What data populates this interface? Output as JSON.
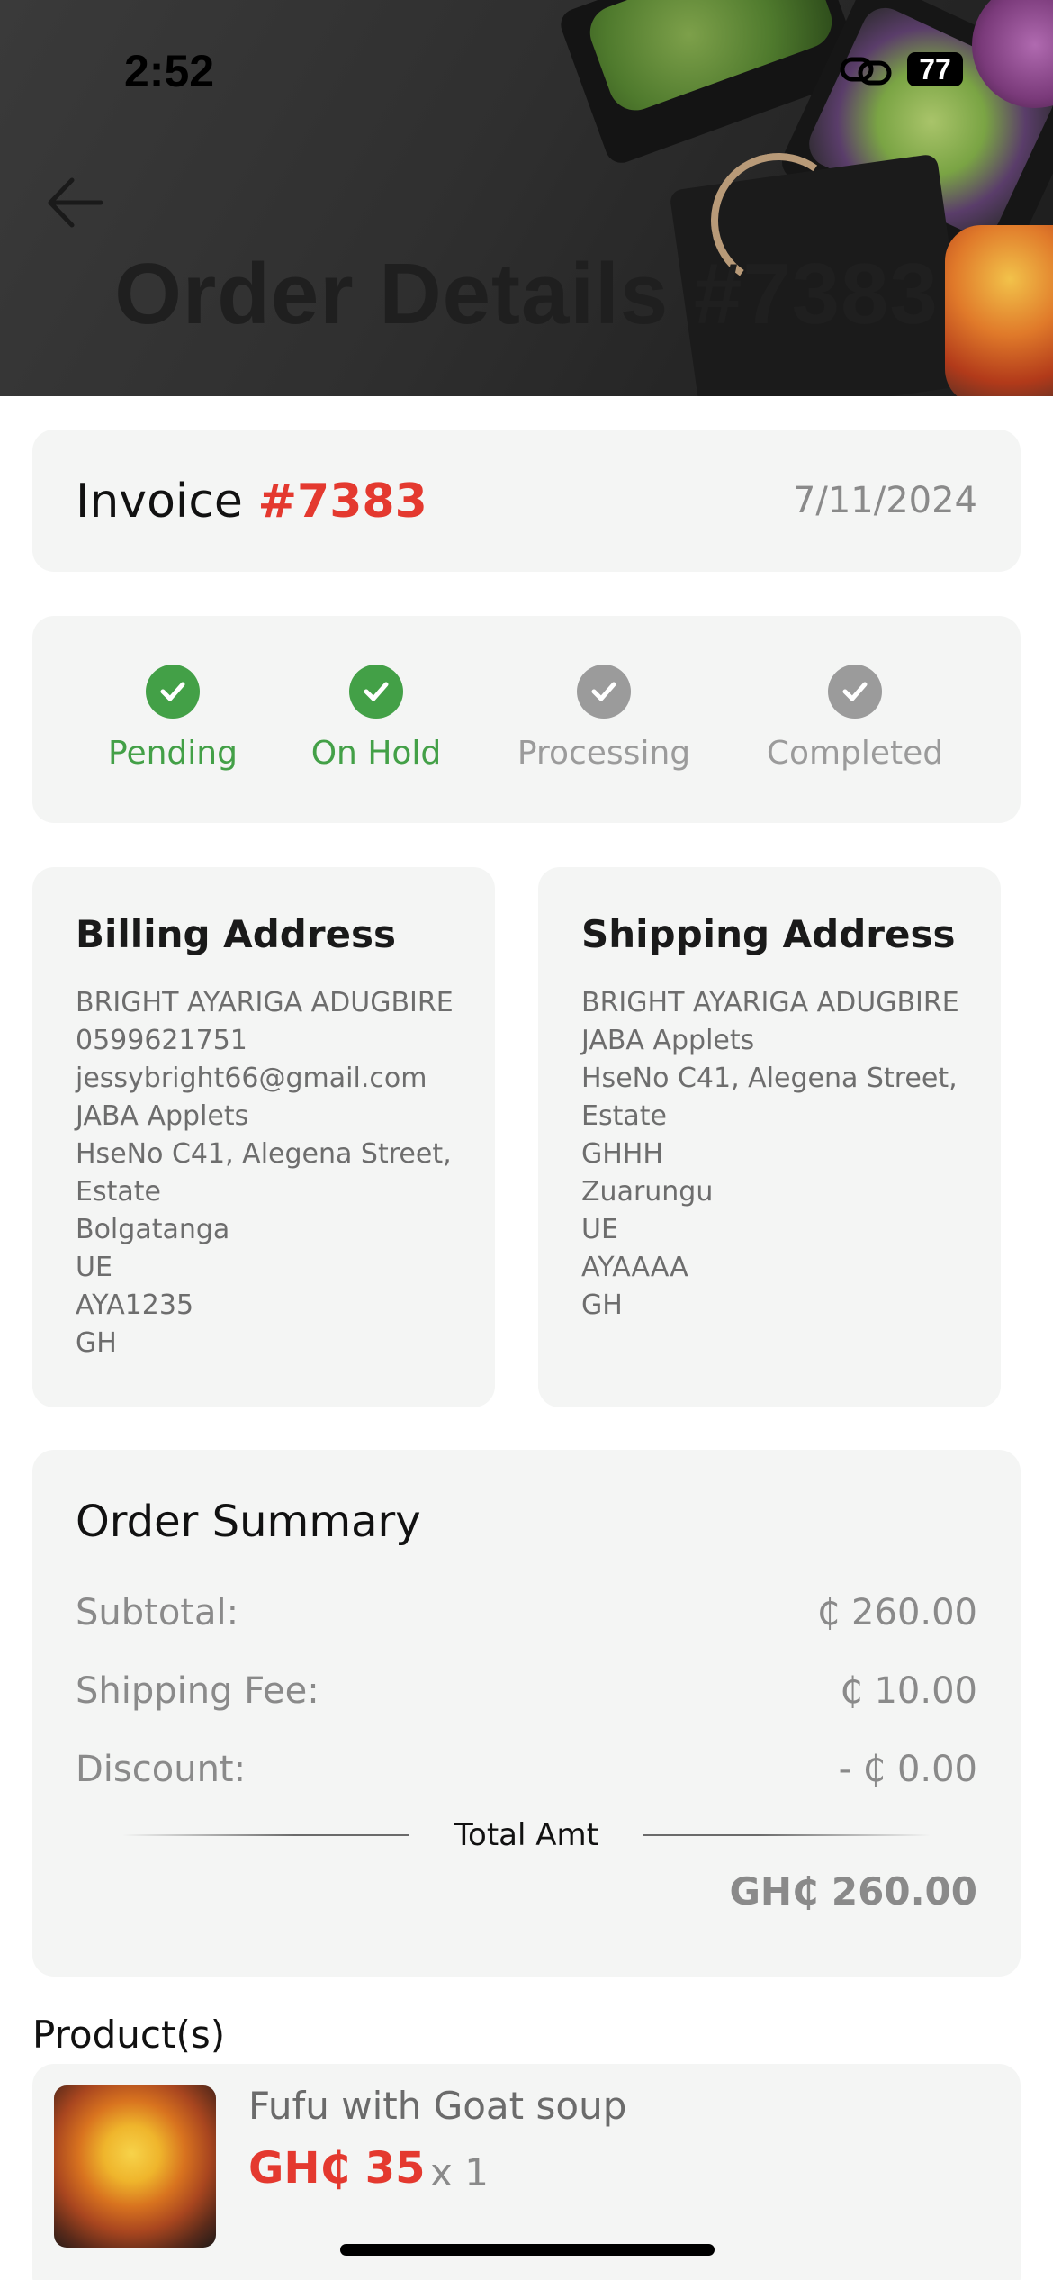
{
  "status_bar": {
    "time": "2:52",
    "battery": "77",
    "link_icon": "link-icon"
  },
  "header": {
    "title": "Order Details #7383",
    "back_icon": "arrow-left-icon"
  },
  "invoice": {
    "label": "Invoice",
    "number": "#7383",
    "date": "7/11/2024"
  },
  "order_status": {
    "steps": [
      {
        "label": "Pending",
        "completed": true
      },
      {
        "label": "On Hold",
        "completed": true
      },
      {
        "label": "Processing",
        "completed": false
      },
      {
        "label": "Completed",
        "completed": false
      }
    ],
    "colors": {
      "done": "#43a047",
      "todo": "#9b9b9b"
    }
  },
  "billing": {
    "title": "Billing Address",
    "lines": [
      "BRIGHT AYARIGA ADUGBIRE",
      "0599621751",
      "jessybright66@gmail.com",
      "JABA Applets",
      "HseNo C41, Alegena Street,",
      "Estate",
      "Bolgatanga",
      "UE",
      "AYA1235",
      "GH"
    ]
  },
  "shipping": {
    "title": "Shipping Address",
    "lines": [
      "BRIGHT AYARIGA ADUGBIRE",
      "JABA Applets",
      "HseNo C41, Alegena Street,",
      "Estate",
      "GHHH",
      "Zuarungu",
      "UE",
      "AYAAAA",
      "GH"
    ]
  },
  "summary": {
    "title": "Order Summary",
    "subtotal_label": "Subtotal:",
    "subtotal_value": "₵ 260.00",
    "shipping_label": "Shipping Fee:",
    "shipping_value": "₵ 10.00",
    "discount_label": "Discount:",
    "discount_value": "- ₵ 0.00",
    "total_label": "Total Amt",
    "total_value": "GH₵ 260.00"
  },
  "products": {
    "heading": "Product(s)",
    "items": [
      {
        "name": "Fufu with Goat soup",
        "price": "GH₵ 35",
        "qty": "x 1"
      }
    ]
  },
  "accent_color": "#e4392f"
}
